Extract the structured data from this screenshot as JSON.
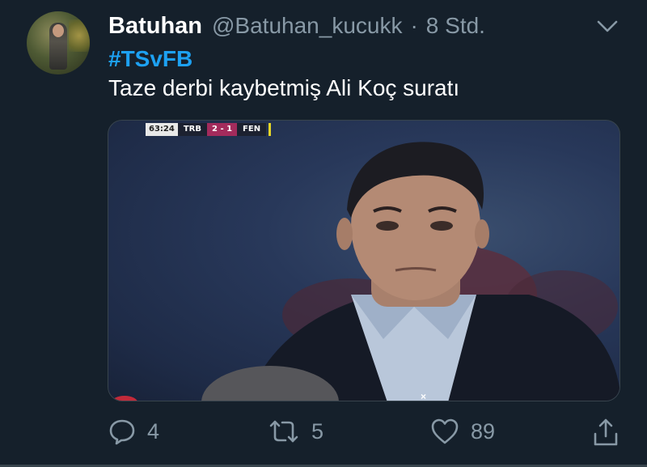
{
  "tweet": {
    "display_name": "Batuhan",
    "handle": "@Batuhan_kucukk",
    "separator": "·",
    "time": "8 Std.",
    "hashtag": "#TSvFB",
    "text": "Taze derbi kaybetmiş Ali Koç suratı"
  },
  "media": {
    "scoreboard": {
      "clock": "63:24",
      "home": "TRB",
      "score": "2 - 1",
      "away": "FEN"
    },
    "close_glyph": "×"
  },
  "actions": {
    "reply_count": "4",
    "retweet_count": "5",
    "like_count": "89"
  },
  "icons": {
    "menu": "chevron-down-icon",
    "reply": "reply-icon",
    "retweet": "retweet-icon",
    "like": "heart-icon",
    "share": "share-icon"
  },
  "colors": {
    "background": "#15202b",
    "text": "#ffffff",
    "secondary": "#8899a6",
    "link": "#1da1f2",
    "score_accent": "#a32b5c"
  }
}
